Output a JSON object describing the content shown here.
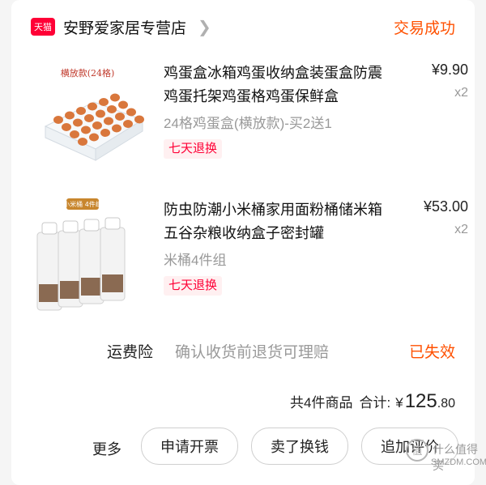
{
  "store": {
    "badge": "天猫",
    "name": "安野爱家居专营店",
    "status": "交易成功"
  },
  "products": [
    {
      "image_label": "横放款(24格)",
      "title": "鸡蛋盒冰箱鸡蛋收纳盒装蛋盒防震鸡蛋托架鸡蛋格鸡蛋保鲜盒",
      "price": "¥9.90",
      "qty": "x2",
      "sku": "24格鸡蛋盒(横放款)-买2送1",
      "tag": "七天退换"
    },
    {
      "image_label": "小米桶 4件组",
      "title": "防虫防潮小米桶家用面粉桶储米箱五谷杂粮收纳盒子密封罐",
      "price": "¥53.00",
      "qty": "x2",
      "sku": "米桶4件组",
      "tag": "七天退换"
    }
  ],
  "insurance": {
    "label": "运费险",
    "desc": "确认收货前退货可理赔",
    "status": "已失效"
  },
  "summary": {
    "count_text": "共4件商品",
    "total_label": "合计:",
    "currency": "¥",
    "total_int": "125",
    "total_dec": ".80"
  },
  "actions": {
    "more": "更多",
    "invoice": "申请开票",
    "resell": "卖了换钱",
    "review": "追加评价"
  },
  "watermark": {
    "text": "什么值得买",
    "domain": "SMZDM.COM"
  },
  "colors": {
    "accent": "#ff5000",
    "tmall_red": "#ff0036"
  }
}
